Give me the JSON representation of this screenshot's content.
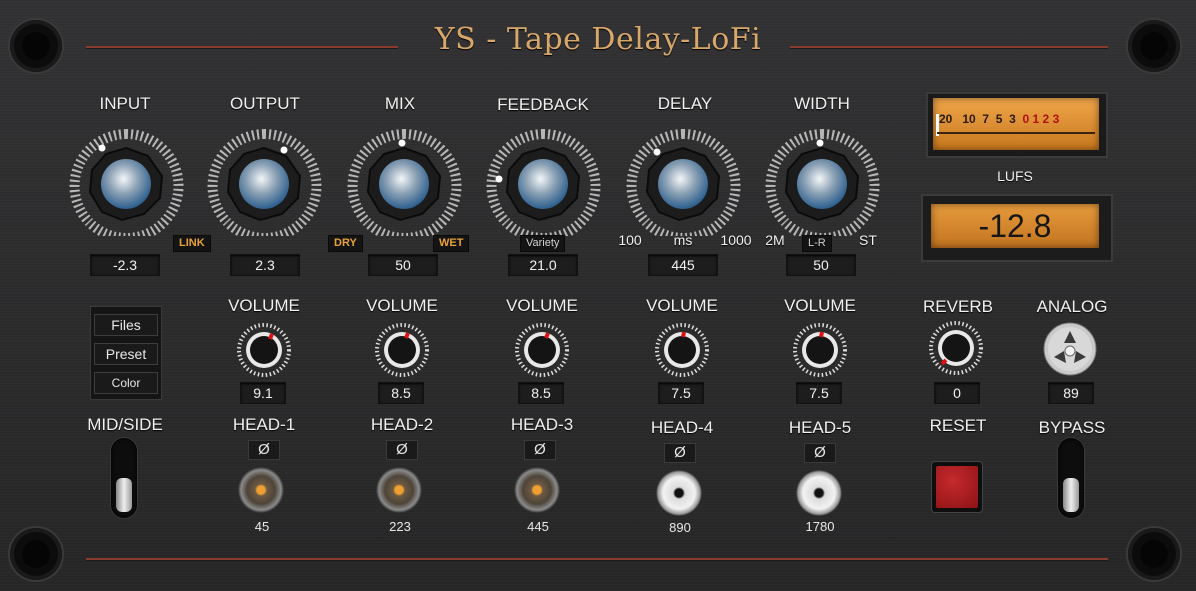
{
  "title": "YS - Tape Delay-LoFi",
  "top_knobs": [
    {
      "label": "INPUT",
      "value": "-2.3"
    },
    {
      "label": "OUTPUT",
      "value": "2.3"
    },
    {
      "label": "MIX",
      "value": "50"
    },
    {
      "label": "FEEDBACK",
      "value": "21.0"
    },
    {
      "label": "DELAY",
      "value": "445"
    },
    {
      "label": "WIDTH",
      "value": "50"
    }
  ],
  "tags": {
    "link": "LINK",
    "dry": "DRY",
    "wet": "WET",
    "variety": "Variety",
    "lr": "L-R"
  },
  "delay_scale": {
    "min": "100",
    "unit": "ms",
    "max": "1000"
  },
  "width_scale": {
    "min": "2M",
    "max": "ST"
  },
  "meter": {
    "scale": [
      "20",
      "10",
      "7",
      "5",
      "3",
      "0",
      "1",
      "2",
      "3"
    ],
    "lufs_label": "LUFS",
    "lufs_value": "-12.8"
  },
  "menu": {
    "files": "Files",
    "preset": "Preset",
    "color": "Color"
  },
  "mid_side_label": "MID/SIDE",
  "heads": [
    {
      "volume_label": "VOLUME",
      "volume": "9.1",
      "name": "HEAD-1",
      "phase": "Ø",
      "time": "45",
      "active": true
    },
    {
      "volume_label": "VOLUME",
      "volume": "8.5",
      "name": "HEAD-2",
      "phase": "Ø",
      "time": "223",
      "active": true
    },
    {
      "volume_label": "VOLUME",
      "volume": "8.5",
      "name": "HEAD-3",
      "phase": "Ø",
      "time": "445",
      "active": true
    },
    {
      "volume_label": "VOLUME",
      "volume": "7.5",
      "name": "HEAD-4",
      "phase": "Ø",
      "time": "890",
      "active": false
    },
    {
      "volume_label": "VOLUME",
      "volume": "7.5",
      "name": "HEAD-5",
      "phase": "Ø",
      "time": "1780",
      "active": false
    }
  ],
  "reverb": {
    "label": "REVERB",
    "value": "0"
  },
  "analog": {
    "label": "ANALOG",
    "value": "89"
  },
  "reset_label": "RESET",
  "bypass_label": "BYPASS",
  "colors": {
    "title": "#d8a76a",
    "accent_rule": "#8a3b2e",
    "meter_bg": "#d88a2a",
    "reset": "#a01518",
    "head_active": "#f0a030",
    "tag_orange": "#e8a23a"
  }
}
